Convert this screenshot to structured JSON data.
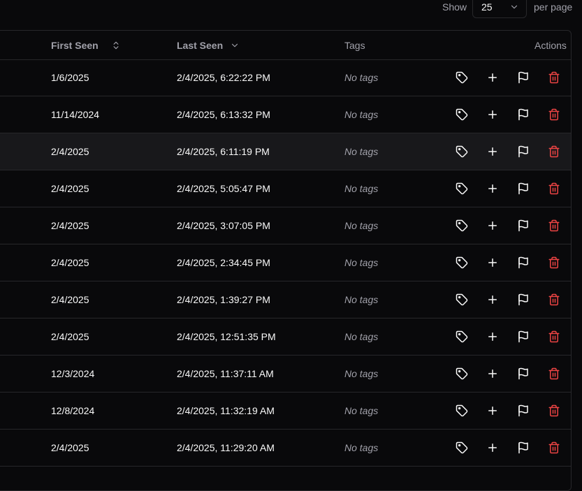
{
  "pagination": {
    "show_label": "Show",
    "per_page_value": "25",
    "per_page_label": "per page"
  },
  "table": {
    "columns": {
      "first_seen": "First Seen",
      "last_seen": "Last Seen",
      "tags": "Tags",
      "actions": "Actions"
    },
    "rows": [
      {
        "first_seen": "1/6/2025",
        "last_seen": "2/4/2025, 6:22:22 PM",
        "tags": "No tags"
      },
      {
        "first_seen": "11/14/2024",
        "last_seen": "2/4/2025, 6:13:32 PM",
        "tags": "No tags"
      },
      {
        "first_seen": "2/4/2025",
        "last_seen": "2/4/2025, 6:11:19 PM",
        "tags": "No tags"
      },
      {
        "first_seen": "2/4/2025",
        "last_seen": "2/4/2025, 5:05:47 PM",
        "tags": "No tags"
      },
      {
        "first_seen": "2/4/2025",
        "last_seen": "2/4/2025, 3:07:05 PM",
        "tags": "No tags"
      },
      {
        "first_seen": "2/4/2025",
        "last_seen": "2/4/2025, 2:34:45 PM",
        "tags": "No tags"
      },
      {
        "first_seen": "2/4/2025",
        "last_seen": "2/4/2025, 1:39:27 PM",
        "tags": "No tags"
      },
      {
        "first_seen": "2/4/2025",
        "last_seen": "2/4/2025, 12:51:35 PM",
        "tags": "No tags"
      },
      {
        "first_seen": "12/3/2024",
        "last_seen": "2/4/2025, 11:37:11 AM",
        "tags": "No tags"
      },
      {
        "first_seen": "12/8/2024",
        "last_seen": "2/4/2025, 11:32:19 AM",
        "tags": "No tags"
      },
      {
        "first_seen": "2/4/2025",
        "last_seen": "2/4/2025, 11:29:20 AM",
        "tags": "No tags"
      }
    ],
    "row_actions": [
      "tag-icon",
      "plus-icon",
      "flag-icon",
      "trash-icon"
    ],
    "hover_row": 2
  },
  "colors": {
    "background": "#09090b",
    "border": "#27272a",
    "text": "#fafafa",
    "muted": "#a1a1aa",
    "danger": "#ef4444",
    "hover": "#18181b"
  }
}
